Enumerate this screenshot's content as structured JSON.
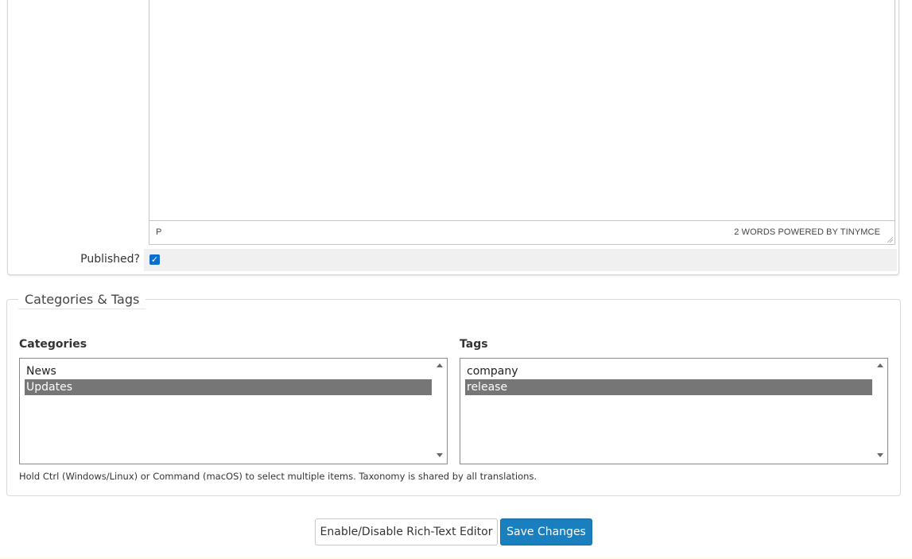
{
  "editor": {
    "status_path": "P",
    "word_count": "2 WORDS POWERED BY TINYMCE"
  },
  "published": {
    "label": "Published?",
    "checked": true
  },
  "taxonomy": {
    "legend": "Categories & Tags",
    "categories_label": "Categories",
    "categories": [
      "News",
      "Updates"
    ],
    "categories_selected": "Updates",
    "tags_label": "Tags",
    "tags": [
      "company",
      "release"
    ],
    "tags_selected": "release",
    "hint": "Hold Ctrl (Windows/Linux) or Command (macOS) to select multiple items. Taxonomy is shared by all translations."
  },
  "actions": {
    "toggle_editor_label": "Enable/Disable Rich-Text Editor",
    "save_label": "Save Changes"
  },
  "colors": {
    "primary": "#1a7fbf",
    "checkbox": "#0b6fcf",
    "selected_option": "#767676"
  }
}
